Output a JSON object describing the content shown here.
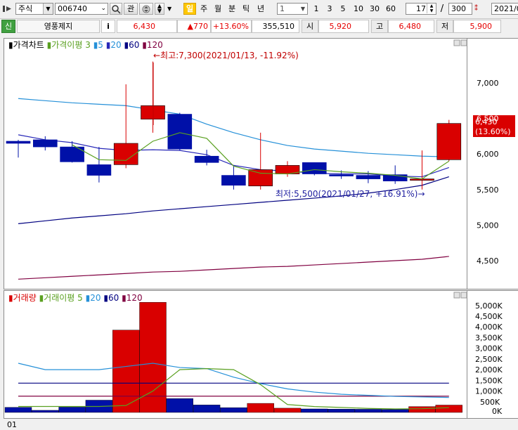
{
  "toolbar": {
    "market_type": "주식",
    "stock_code": "006740",
    "btn_gwan": "관",
    "period_buttons": [
      "일",
      "주",
      "월",
      "분",
      "틱",
      "년"
    ],
    "interval_select": "1",
    "interval_buttons": [
      "1",
      "3",
      "5",
      "10",
      "30",
      "60"
    ],
    "view_count": "17",
    "slash": "/",
    "total_count": "300",
    "date": "2021/0"
  },
  "info_bar": {
    "badge": "신",
    "stock_name": "영풍제지",
    "info_icon": "i",
    "price": "6,430",
    "change": "▲770",
    "change_pct": "+13.60%",
    "volume": "355,510",
    "open_label": "시",
    "open": "5,920",
    "high_label": "고",
    "high": "6,480",
    "low_label": "저",
    "low": "5,900"
  },
  "colors": {
    "up": "#d90000",
    "down": "#0010a8",
    "ma3": "#5aa020",
    "ma5": "#2590d8",
    "ma20": "#2828b8",
    "ma60": "#000080",
    "ma120": "#800040",
    "info_up": "#e60000"
  },
  "price_chart": {
    "legend": {
      "title": "가격차트",
      "ma_label": "가격이평",
      "ma3": "3",
      "ma5": "5",
      "ma20": "20",
      "ma60": "60",
      "ma120": "120"
    },
    "high_annotation": "←최고:7,300(2021/01/13, -11.92%)",
    "low_annotation": "최저:5,500(2021/01/27, +16.91%)→",
    "current_price": "6,430",
    "current_pct": "(13.60%)",
    "y_ticks": [
      "7,000",
      "6,500",
      "6,000",
      "5,500",
      "5,000",
      "4,500"
    ]
  },
  "volume_chart": {
    "legend": {
      "title": "거래량",
      "ma_label": "거래이평",
      "ma5": "5",
      "ma20": "20",
      "ma60": "60",
      "ma120": "120"
    },
    "y_ticks": [
      "5,000K",
      "4,500K",
      "4,000K",
      "3,500K",
      "3,000K",
      "2,500K",
      "2,000K",
      "1,500K",
      "1,000K",
      "500K",
      "0K"
    ]
  },
  "footer": {
    "x_label": "01"
  },
  "chart_data": {
    "type": "candlestick",
    "ylim": [
      4150,
      7550
    ],
    "candles": [
      {
        "open": 6180,
        "high": 6200,
        "low": 5950,
        "close": 6150
      },
      {
        "open": 6200,
        "high": 6250,
        "low": 6050,
        "close": 6100
      },
      {
        "open": 6100,
        "high": 6180,
        "low": 5880,
        "close": 5890
      },
      {
        "open": 5850,
        "high": 6100,
        "low": 5600,
        "close": 5700
      },
      {
        "open": 5850,
        "high": 6980,
        "low": 5800,
        "close": 6150
      },
      {
        "open": 6490,
        "high": 7300,
        "low": 6300,
        "close": 6680
      },
      {
        "open": 6560,
        "high": 6580,
        "low": 6050,
        "close": 6070
      },
      {
        "open": 5970,
        "high": 6060,
        "low": 5840,
        "close": 5880
      },
      {
        "open": 5700,
        "high": 5830,
        "low": 5500,
        "close": 5560
      },
      {
        "open": 5550,
        "high": 6300,
        "low": 5500,
        "close": 5780
      },
      {
        "open": 5720,
        "high": 5900,
        "low": 5680,
        "close": 5840
      },
      {
        "open": 5880,
        "high": 5880,
        "low": 5700,
        "close": 5720
      },
      {
        "open": 5710,
        "high": 5770,
        "low": 5650,
        "close": 5690
      },
      {
        "open": 5700,
        "high": 5760,
        "low": 5590,
        "close": 5650
      },
      {
        "open": 5710,
        "high": 5840,
        "low": 5580,
        "close": 5620
      },
      {
        "open": 5630,
        "high": 6050,
        "low": 5500,
        "close": 5650
      },
      {
        "open": 5920,
        "high": 6480,
        "low": 5900,
        "close": 6430
      }
    ],
    "price_ma": {
      "ma3": [
        null,
        null,
        6130,
        5920,
        5910,
        6180,
        6300,
        6220,
        5830,
        5730,
        5720,
        5780,
        5750,
        5730,
        5700,
        5650,
        5900
      ],
      "ma5": [
        6780,
        6750,
        6720,
        6700,
        6680,
        6620,
        6560,
        6420,
        6300,
        6200,
        6120,
        6070,
        6040,
        6010,
        5990,
        5970,
        5960
      ],
      "ma20": [
        6270,
        6200,
        6160,
        6080,
        6050,
        6060,
        6050,
        5990,
        5840,
        5780,
        5760,
        5730,
        5720,
        5720,
        5690,
        5680,
        5810
      ],
      "ma60": [
        5020,
        5060,
        5100,
        5130,
        5160,
        5200,
        5230,
        5260,
        5290,
        5320,
        5350,
        5380,
        5410,
        5450,
        5500,
        5560,
        5680
      ],
      "ma120": [
        4240,
        4260,
        4280,
        4300,
        4320,
        4340,
        4350,
        4370,
        4390,
        4410,
        4420,
        4440,
        4460,
        4480,
        4500,
        4520,
        4560
      ]
    },
    "volume": [
      480,
      200,
      500,
      1150,
      7700,
      10300,
      1300,
      700,
      450,
      850,
      400,
      330,
      310,
      300,
      280,
      550,
      690
    ],
    "volume_unit": "K (scaled ×0.5)",
    "volume_ma": {
      "ma5": [
        560,
        560,
        560,
        560,
        650,
        2000,
        4000,
        4100,
        4000,
        2600,
        740,
        550,
        470,
        380,
        330,
        350,
        450
      ],
      "ma20": [
        4600,
        4000,
        4000,
        4000,
        4300,
        4600,
        4200,
        4100,
        3300,
        2700,
        2200,
        1900,
        1700,
        1600,
        1500,
        1450,
        1400
      ],
      "ma60": [
        2740,
        2740,
        2740,
        2740,
        2740,
        2740,
        2740,
        2740,
        2740,
        2740,
        2740,
        2740,
        2740,
        2740,
        2740,
        2740,
        2740
      ],
      "ma120": [
        1520,
        1520,
        1520,
        1520,
        1520,
        1520,
        1520,
        1520,
        1520,
        1520,
        1520,
        1520,
        1520,
        1520,
        1520,
        1520,
        1520
      ]
    }
  }
}
